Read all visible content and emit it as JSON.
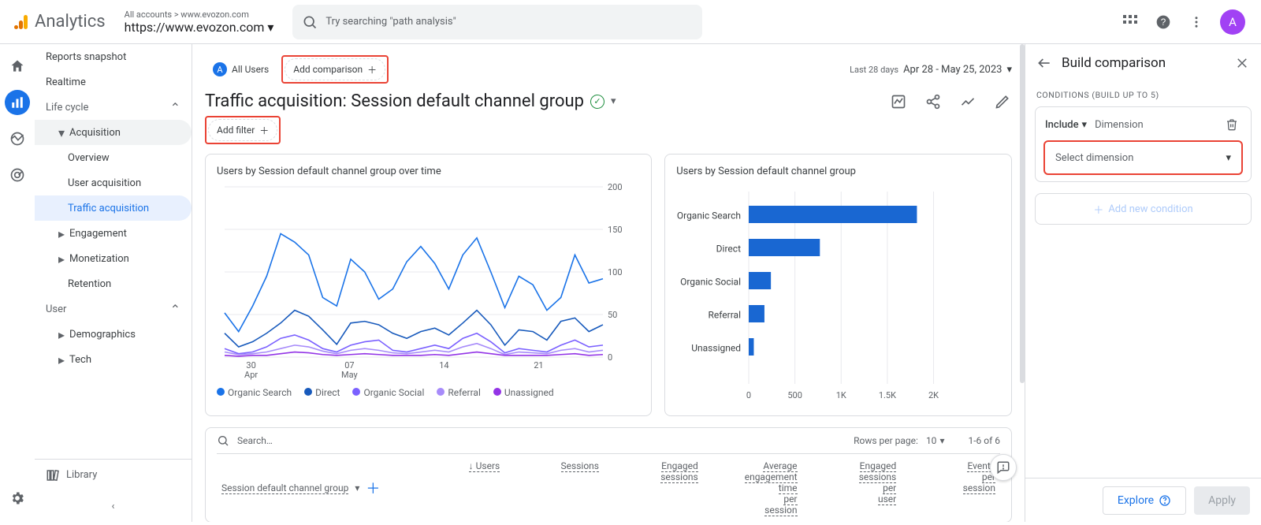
{
  "header": {
    "logo_label": "Analytics",
    "account_path": "All accounts > www.evozon.com",
    "account_property": "https://www.evozon.com",
    "search_placeholder": "Try searching \"path analysis\"",
    "avatar_initial": "A"
  },
  "nav": {
    "reports_snapshot": "Reports snapshot",
    "realtime": "Realtime",
    "life_cycle": "Life cycle",
    "acquisition": "Acquisition",
    "overview": "Overview",
    "user_acq": "User acquisition",
    "traffic_acq": "Traffic acquisition",
    "engagement": "Engagement",
    "monetization": "Monetization",
    "retention": "Retention",
    "user": "User",
    "demographics": "Demographics",
    "tech": "Tech",
    "library": "Library"
  },
  "report": {
    "all_users_badge": "A",
    "all_users": "All Users",
    "add_comparison": "Add comparison",
    "title": "Traffic acquisition: Session default channel group",
    "add_filter": "Add filter",
    "date_context": "Last 28 days",
    "date_range": "Apr 28 - May 25, 2023",
    "line_title": "Users by Session default channel group over time",
    "bar_title": "Users by Session default channel group",
    "search_placeholder": "Search…",
    "rows_label": "Rows per page:",
    "rows_value": "10",
    "rows_range": "1-6 of 6",
    "dim_header": "Session default channel group",
    "columns": [
      "Users",
      "Sessions",
      "Engaged sessions",
      "Average engagement time per session",
      "Engaged sessions per user",
      "Events per session"
    ],
    "legend": [
      "Organic Search",
      "Direct",
      "Organic Social",
      "Referral",
      "Unassigned"
    ]
  },
  "chart_data": {
    "line": {
      "type": "line",
      "ylim": [
        0,
        200
      ],
      "yticks": [
        0,
        50,
        100,
        150,
        200
      ],
      "x_labels": [
        {
          "pos": 0.14,
          "text": "30"
        },
        {
          "pos": 0.14,
          "sub": "Apr"
        },
        {
          "pos": 0.4,
          "text": "07"
        },
        {
          "pos": 0.4,
          "sub": "May"
        },
        {
          "pos": 0.66,
          "text": "14"
        },
        {
          "pos": 0.9,
          "text": "21"
        }
      ],
      "series": [
        {
          "name": "Organic Search",
          "color": "#1a73e8",
          "values": [
            52,
            30,
            60,
            95,
            145,
            135,
            120,
            70,
            60,
            115,
            100,
            68,
            80,
            112,
            130,
            110,
            80,
            120,
            140,
            100,
            58,
            95,
            85,
            55,
            70,
            120,
            87,
            92
          ]
        },
        {
          "name": "Direct",
          "color": "#185abc",
          "values": [
            28,
            12,
            18,
            28,
            40,
            55,
            48,
            32,
            15,
            40,
            42,
            38,
            28,
            22,
            30,
            34,
            26,
            40,
            55,
            38,
            14,
            32,
            30,
            20,
            42,
            46,
            30,
            38
          ]
        },
        {
          "name": "Organic Social",
          "color": "#7b61ff",
          "values": [
            10,
            4,
            6,
            12,
            22,
            26,
            20,
            10,
            6,
            14,
            18,
            20,
            8,
            6,
            10,
            14,
            10,
            22,
            28,
            18,
            5,
            10,
            8,
            6,
            14,
            20,
            12,
            14
          ]
        },
        {
          "name": "Referral",
          "color": "#a78bfa",
          "values": [
            6,
            3,
            4,
            6,
            10,
            14,
            12,
            7,
            4,
            8,
            10,
            8,
            5,
            4,
            6,
            8,
            6,
            12,
            16,
            10,
            3,
            6,
            5,
            4,
            8,
            10,
            6,
            8
          ]
        },
        {
          "name": "Unassigned",
          "color": "#9334e6",
          "values": [
            2,
            1,
            2,
            2,
            4,
            6,
            5,
            3,
            2,
            3,
            4,
            3,
            2,
            2,
            2,
            3,
            2,
            4,
            6,
            4,
            2,
            2,
            2,
            2,
            3,
            4,
            2,
            3
          ]
        }
      ]
    },
    "bar": {
      "type": "bar",
      "xlim": [
        0,
        2200
      ],
      "xticks": [
        0,
        500,
        "1K",
        "1.5K",
        "2K"
      ],
      "categories": [
        "Organic Search",
        "Direct",
        "Organic Social",
        "Referral",
        "Unassigned"
      ],
      "values": [
        1820,
        770,
        240,
        170,
        55
      ],
      "color": "#1967d2"
    }
  },
  "sidepanel": {
    "title": "Build comparison",
    "conditions_label": "CONDITIONS (BUILD UP TO 5)",
    "include": "Include",
    "dimension_label": "Dimension",
    "select_dimension": "Select dimension",
    "add_new": "Add new condition",
    "explore": "Explore",
    "apply": "Apply"
  }
}
